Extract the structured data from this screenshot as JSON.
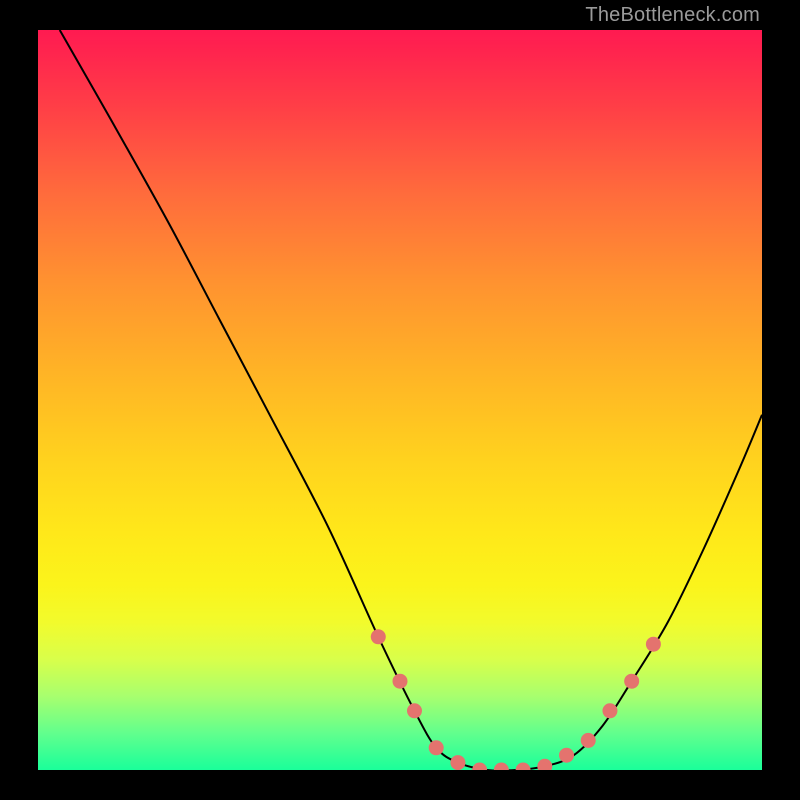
{
  "watermark": "TheBottleneck.com",
  "colors": {
    "curve": "#000000",
    "marker_fill": "#e4736e",
    "marker_stroke": "#d05c58",
    "background": "#000000"
  },
  "chart_data": {
    "type": "line",
    "title": "",
    "xlabel": "",
    "ylabel": "",
    "xlim": [
      0,
      1
    ],
    "ylim": [
      0,
      100
    ],
    "grid": false,
    "legend": false,
    "series": [
      {
        "name": "bottleneck-curve",
        "x": [
          0.03,
          0.1,
          0.18,
          0.25,
          0.32,
          0.4,
          0.47,
          0.52,
          0.55,
          0.58,
          0.62,
          0.66,
          0.7,
          0.74,
          0.78,
          0.82,
          0.87,
          0.92,
          0.97,
          1.0
        ],
        "y": [
          100,
          88,
          74,
          61,
          48,
          33,
          18,
          8,
          3,
          1,
          0,
          0,
          0.5,
          2,
          6,
          12,
          20,
          30,
          41,
          48
        ]
      }
    ],
    "markers": {
      "name": "highlight-points",
      "x": [
        0.47,
        0.5,
        0.52,
        0.55,
        0.58,
        0.61,
        0.64,
        0.67,
        0.7,
        0.73,
        0.76,
        0.79,
        0.82,
        0.85
      ],
      "y": [
        18,
        12,
        8,
        3,
        1,
        0,
        0,
        0,
        0.5,
        2,
        4,
        8,
        12,
        17
      ]
    }
  }
}
